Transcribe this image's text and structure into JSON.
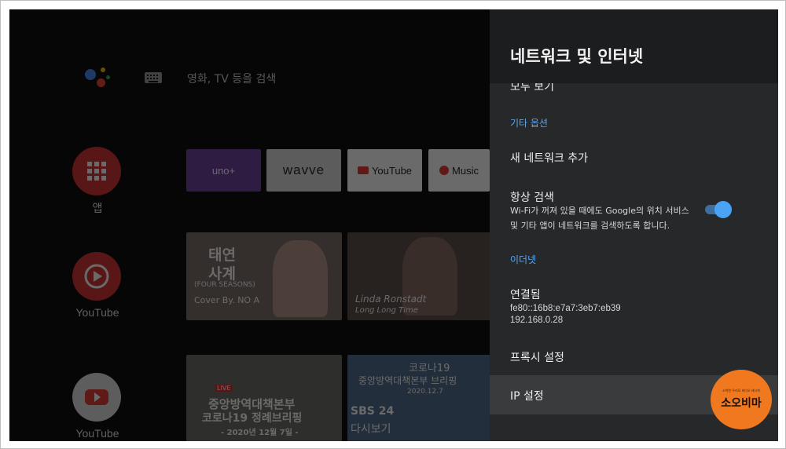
{
  "home": {
    "search_placeholder": "영화, TV 등을 검색",
    "side_apps": [
      {
        "label": "앱",
        "color": "#d32f2f"
      },
      {
        "label": "YouTube",
        "color": "#d32f2f"
      },
      {
        "label": "YouTube",
        "color": "#e0e0e0"
      }
    ],
    "app_chips": [
      {
        "label": "uno+",
        "color": "#6a3fa0"
      },
      {
        "label": "wavve",
        "color": "#e0e0e0"
      },
      {
        "label": "YouTube",
        "color": "#ffffff"
      },
      {
        "label": "Music",
        "color": "#ffffff"
      }
    ],
    "tiles": [
      {
        "title": "태연",
        "subtitle": "사계",
        "caption": "(FOUR SEASONS)",
        "credit": "Cover By. NO A"
      },
      {
        "title": "Linda Ronstadt",
        "subtitle": "Long Long Time"
      },
      {
        "badge": "LIVE",
        "title": "중앙방역대책본부",
        "subtitle": "코로나19 정례브리핑",
        "caption": "- 2020년 12월 7일 -"
      },
      {
        "title": "코로나19",
        "subtitle": "중앙방역대책본부 브리핑",
        "caption": "2020.12.7",
        "badge": "SBS 24",
        "extra": "다시보기"
      }
    ]
  },
  "panel": {
    "title": "네트워크 및 인터넷",
    "see_all": "모두 보기",
    "other_options_header": "기타 옵션",
    "add_network": "새 네트워크 추가",
    "always_scan": {
      "label": "항상 검색",
      "description_line1": "Wi-Fi가 꺼져 있을 때에도 Google의 위치 서비스",
      "description_line2": "및 기타 앱이 네트워크를 검색하도록 합니다.",
      "enabled": true
    },
    "ethernet_header": "이더넷",
    "connected": {
      "label": "연결됨",
      "ipv6": "fe80::16b8:e7a7:3eb7:eb39",
      "ipv4": "192.168.0.28"
    },
    "proxy_settings": "프록시 설정",
    "ip_settings": "IP 설정"
  },
  "watermark": {
    "small_text": "소박한 우리모 비다오 레시피",
    "big_text": "소오비마"
  },
  "colors": {
    "panel_bg": "#27282a",
    "header_bg": "#1c1d1f",
    "accent_blue": "#5aa7f0",
    "toggle_on": "#4ba3f5",
    "focus_row": "#3a3b3d"
  }
}
